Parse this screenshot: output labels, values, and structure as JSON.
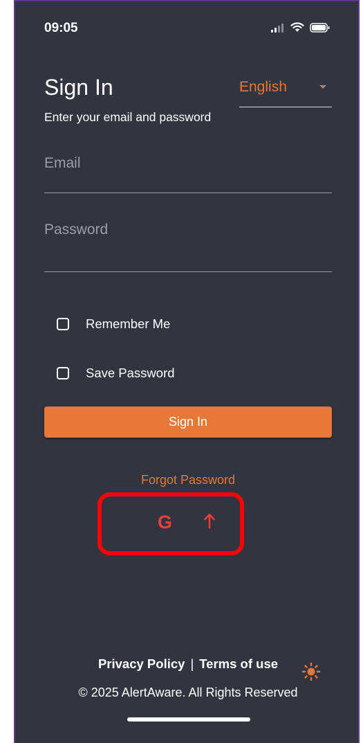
{
  "status_bar": {
    "time": "09:05",
    "icons": [
      "cellular-signal-icon",
      "wifi-icon",
      "battery-icon"
    ]
  },
  "header": {
    "title": "Sign In",
    "subtitle": "Enter your email and password",
    "language": {
      "selected": "English",
      "icon": "dropdown-caret-icon"
    }
  },
  "form": {
    "email_placeholder": "Email",
    "email_value": "",
    "password_placeholder": "Password",
    "password_value": "",
    "remember_me_label": "Remember Me",
    "remember_me_checked": false,
    "save_password_label": "Save Password",
    "save_password_checked": false,
    "sign_in_button": "Sign In",
    "forgot_password": "Forgot Password"
  },
  "social": {
    "google_icon_glyph": "G",
    "icons": [
      "google-icon",
      "arrow-up-icon"
    ]
  },
  "footer": {
    "privacy_policy": "Privacy Policy",
    "separator": "|",
    "terms_of_use": "Terms of use",
    "theme_icon": "sun-icon",
    "copyright": "© 2025 AlertAware. All Rights Reserved"
  },
  "colors": {
    "background": "#323440",
    "accent": "#e8773a",
    "highlight": "#ff0000",
    "google_red": "#ea4335"
  }
}
